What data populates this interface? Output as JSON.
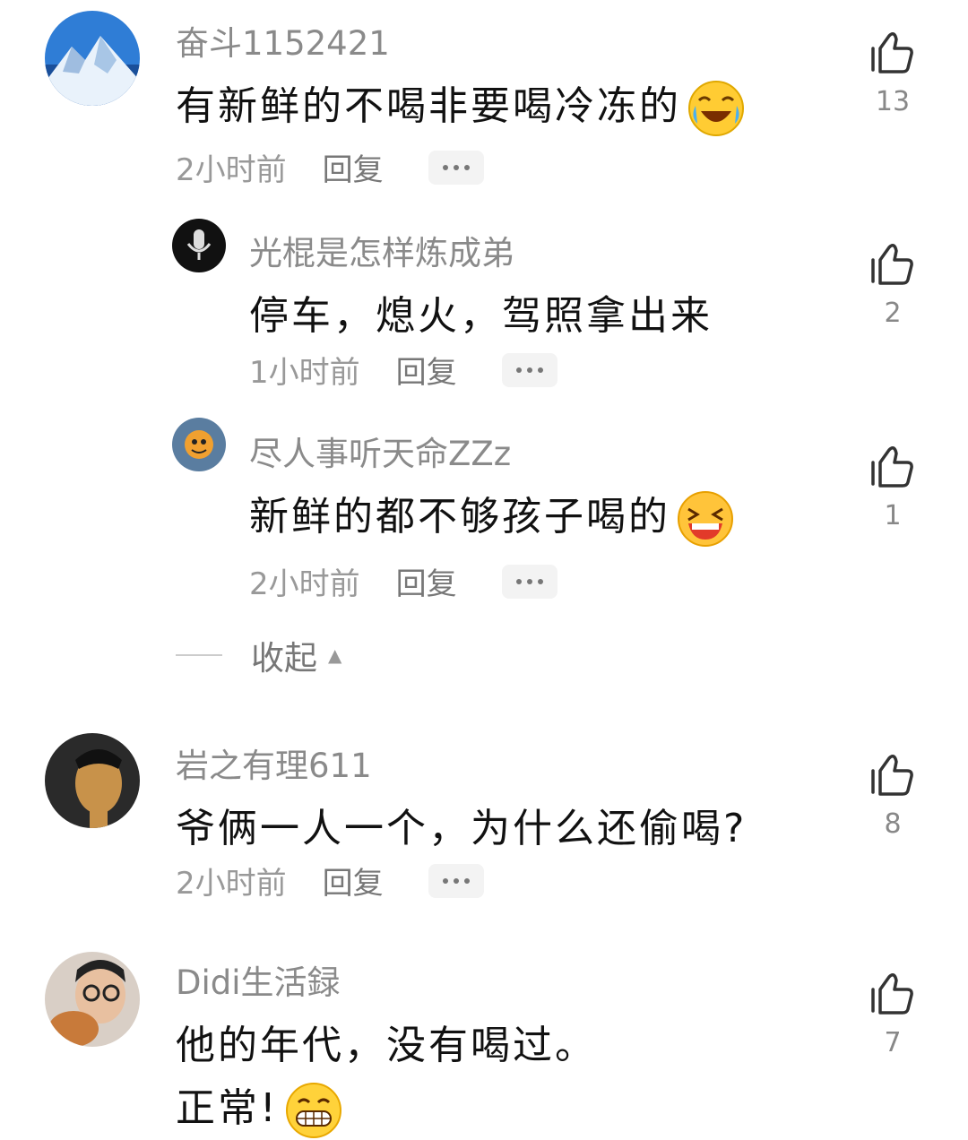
{
  "comments": [
    {
      "username": "奋斗1152421",
      "content": "有新鲜的不喝非要喝冷冻的",
      "time": "2小时前",
      "reply": "回复",
      "likes": "13",
      "emoji": "laughing-crying-emoji",
      "replies": [
        {
          "username": "光棍是怎样炼成弟",
          "content": "停车，熄火，驾照拿出来",
          "time": "1小时前",
          "reply": "回复",
          "likes": "2"
        },
        {
          "username": "尽人事听天命ZZz",
          "content": "新鲜的都不够孩子喝的",
          "time": "2小时前",
          "reply": "回复",
          "likes": "1",
          "emoji": "grinning-squint-emoji"
        }
      ],
      "collapse_label": "收起"
    },
    {
      "username": "岩之有理611",
      "content": "爷俩一人一个，为什么还偷喝?",
      "time": "2小时前",
      "reply": "回复",
      "likes": "8"
    },
    {
      "username": "Didi生活録",
      "content": "他的年代，没有喝过。",
      "content_line2": "正常!",
      "likes": "7",
      "emoji": "grinning-emoji"
    }
  ],
  "colors": {
    "text": "#111111",
    "meta": "#999999",
    "username": "#8a8a8a"
  }
}
